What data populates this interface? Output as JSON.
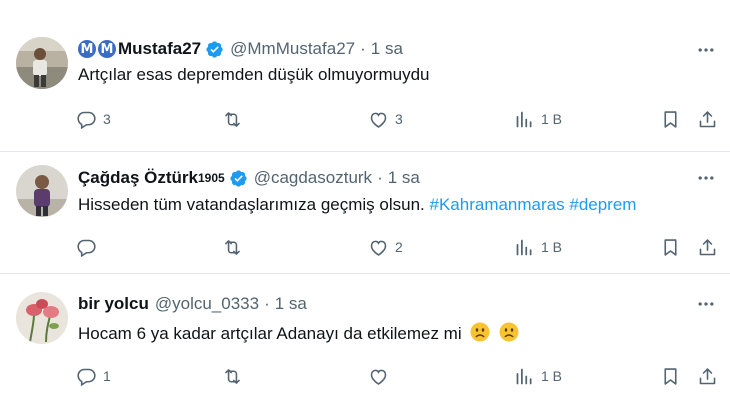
{
  "tweets": [
    {
      "display_name": "Mustafa27",
      "name_badges": [
        "M",
        "M"
      ],
      "handle": "@MmMustafa27",
      "separator": "·",
      "time": "1 sa",
      "verified": true,
      "text": "Artçılar esas depremden düşük olmuyormuydu",
      "replies": "3",
      "retweets": "",
      "likes": "3",
      "views": "1 B"
    },
    {
      "display_name": "Çağdaş Öztürk",
      "name_superscript": "1905",
      "handle": "@cagdasozturk",
      "separator": "·",
      "time": "1 sa",
      "verified": true,
      "text": "Hisseden tüm vatandaşlarımıza geçmiş olsun.",
      "hashtags": [
        "#Kahramanmaras",
        "#deprem"
      ],
      "replies": "",
      "retweets": "",
      "likes": "2",
      "views": "1 B"
    },
    {
      "display_name": "bir yolcu",
      "handle": "@yolcu_0333",
      "separator": "·",
      "time": "1 sa",
      "verified": false,
      "text": "Hocam 6 ya kadar artçılar Adanayı da etkilemez mi",
      "emojis": [
        "frowning-face",
        "frowning-face"
      ],
      "replies": "1",
      "retweets": "",
      "likes": "",
      "views": "1 B"
    }
  ],
  "colors": {
    "text": "#0f1419",
    "secondary": "#536471",
    "link": "#1d9bf0",
    "verified": "#1d9bf0",
    "divider": "#e3e7ea"
  }
}
